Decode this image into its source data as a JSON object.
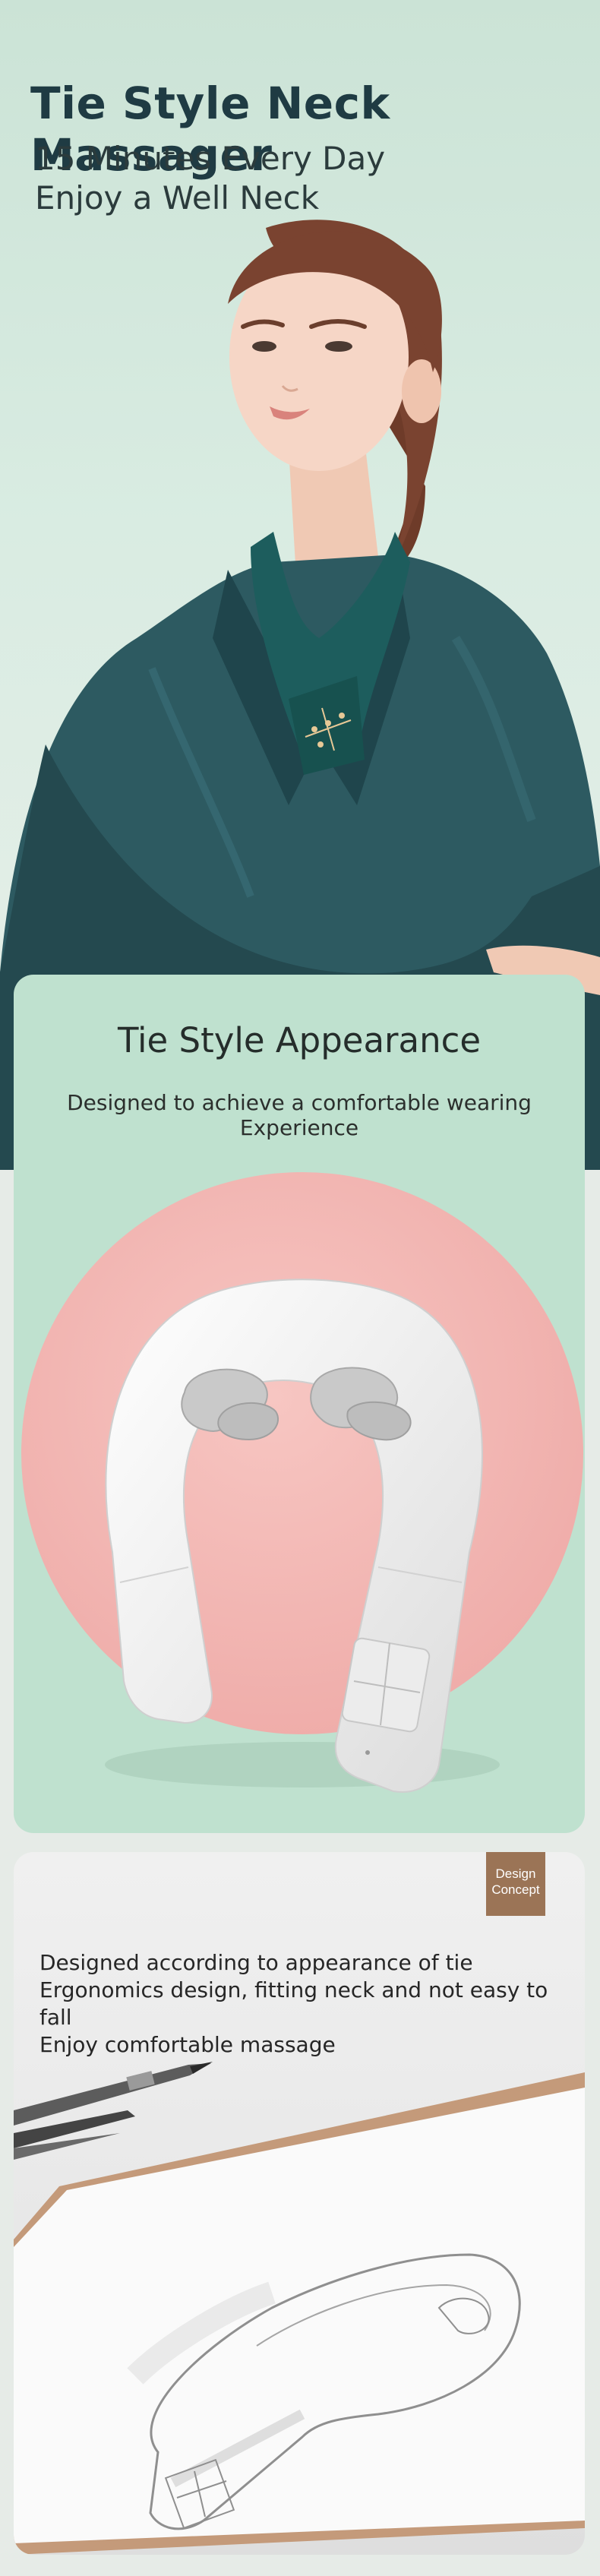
{
  "hero": {
    "title": "Tie Style Neck Massager",
    "subtitle_line1": "15 Minutes Every Day",
    "subtitle_line2": "Enjoy a Well Neck"
  },
  "appearance_card": {
    "title": "Tie Style Appearance",
    "subtitle": "Designed to achieve a comfortable wearing Experience"
  },
  "design_card": {
    "badge_line1": "Design",
    "badge_line2": "Concept",
    "lines": [
      "Designed according to appearance of tie",
      "Ergonomics design, fitting neck and not easy to fall",
      "Enjoy comfortable massage"
    ]
  },
  "colors": {
    "hero_bg": "#cfe6d9",
    "blouse": "#28535a",
    "card_green": "#bfe1cf",
    "pink_circle": "#f2b8b5",
    "badge": "#9b7456",
    "title_text": "#1f3b43"
  }
}
